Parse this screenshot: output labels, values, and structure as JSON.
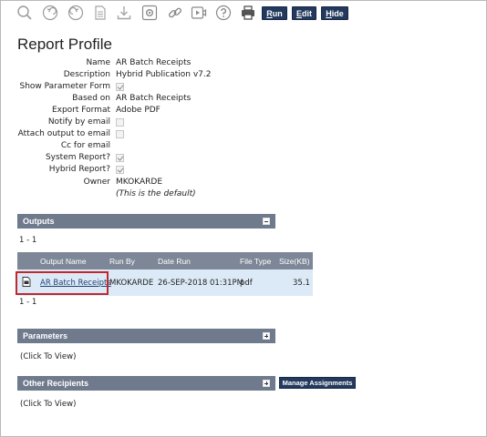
{
  "toolbar": {
    "icons": [
      "search-icon",
      "undo-icon",
      "redo-icon",
      "document-icon",
      "download-icon",
      "settings-icon",
      "link-icon",
      "video-icon",
      "help-icon",
      "print-icon"
    ],
    "run_mnemonic": "R",
    "run_rest": "un",
    "edit_mnemonic": "E",
    "edit_rest": "dit",
    "hide_mnemonic": "H",
    "hide_rest": "ide"
  },
  "page_title": "Report Profile",
  "properties": {
    "name_label": "Name",
    "name_value": "AR Batch Receipts",
    "description_label": "Description",
    "description_value": "Hybrid Publication v7.2",
    "show_param_label": "Show Parameter Form",
    "show_param_checked": true,
    "based_on_label": "Based on",
    "based_on_value": "AR Batch Receipts",
    "export_format_label": "Export Format",
    "export_format_value": "Adobe PDF",
    "notify_label": "Notify by email",
    "notify_checked": false,
    "attach_label": "Attach output to email",
    "attach_checked": false,
    "cc_label": "Cc for email",
    "system_report_label": "System Report?",
    "system_report_checked": true,
    "hybrid_report_label": "Hybrid Report?",
    "hybrid_report_checked": true,
    "owner_label": "Owner",
    "owner_value": "MKOKARDE",
    "owner_note": "(This is the default)"
  },
  "outputs": {
    "title": "Outputs",
    "pagination_top": "1 - 1",
    "pagination_bottom": "1 - 1",
    "columns": [
      "Output Name",
      "Run By",
      "Date Run",
      "File Type",
      "Size(KB)"
    ],
    "rows": [
      {
        "name": "AR Batch Receipts",
        "run_by": "MKOKARDE",
        "date_run": "26-SEP-2018 01:31PM",
        "file_type": "pdf",
        "size": "35.1"
      }
    ]
  },
  "parameters": {
    "title": "Parameters",
    "placeholder": "(Click To View)"
  },
  "other_recipients": {
    "title": "Other Recipients",
    "placeholder": "(Click To View)",
    "manage_label": "Manage Assignments"
  }
}
